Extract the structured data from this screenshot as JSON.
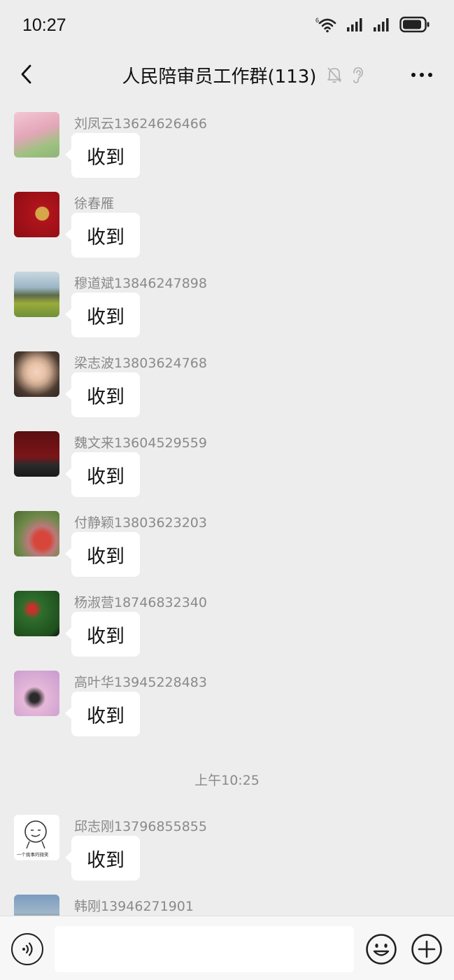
{
  "status_bar": {
    "time": "10:27",
    "icons": [
      "wifi-6-icon",
      "signal-icon",
      "signal-icon",
      "battery-icon"
    ],
    "wifi_badge": "6"
  },
  "nav": {
    "back_icon": "chevron-left-icon",
    "title": "人民陪审员工作群(113)",
    "title_icons": [
      "bell-muted-icon",
      "ear-icon"
    ],
    "more_icon": "ellipsis-icon"
  },
  "messages": [
    {
      "sender": "刘凤云13624626466",
      "text": "收到",
      "avatar_colors": [
        "#e3a6b8",
        "#8fb37a"
      ]
    },
    {
      "sender": "徐春雁",
      "text": "收到",
      "avatar_colors": [
        "#b0141c",
        "#d7a64a"
      ]
    },
    {
      "sender": "穆道斌13846247898",
      "text": "收到",
      "avatar_colors": [
        "#9bb6c6",
        "#6f8f3a"
      ]
    },
    {
      "sender": "梁志波13803624768",
      "text": "收到",
      "avatar_colors": [
        "#c7a58c",
        "#4b3a30"
      ]
    },
    {
      "sender": "魏文来13604529559",
      "text": "收到",
      "avatar_colors": [
        "#7b1518",
        "#2a2a2a"
      ]
    },
    {
      "sender": "付静颖13803623203",
      "text": "收到",
      "avatar_colors": [
        "#6e8a4a",
        "#d8453a"
      ]
    },
    {
      "sender": "杨淑营18746832340",
      "text": "收到",
      "avatar_colors": [
        "#2f6e2c",
        "#c4322b"
      ]
    },
    {
      "sender": "高叶华13945228483",
      "text": "收到",
      "avatar_colors": [
        "#e6b8d8",
        "#c79ad0"
      ]
    }
  ],
  "timestamp": "上午10:25",
  "messages_after": [
    {
      "sender": "邱志刚13796855855",
      "text": "收到",
      "avatar_colors": [
        "#ffffff",
        "#333333"
      ],
      "avatar_caption": "一个挑事的微笑"
    },
    {
      "sender": "韩刚13946271901",
      "text": "",
      "avatar_colors": [
        "#7a9cc0",
        "#4a5a3a"
      ]
    }
  ],
  "input_bar": {
    "voice_icon": "voice-icon",
    "emoji_icon": "emoji-icon",
    "plus_icon": "plus-circle-icon",
    "input_value": ""
  },
  "colors": {
    "background": "#ededed",
    "bubble": "#ffffff",
    "sender_text": "#8a8a8a"
  }
}
